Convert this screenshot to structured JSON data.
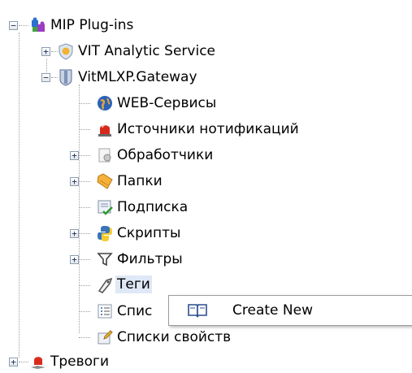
{
  "tree": {
    "root": {
      "label": "MIP Plug-ins",
      "expander": "−"
    },
    "vit_analytic": {
      "label": "VIT Analytic Service",
      "expander": "+"
    },
    "gateway": {
      "label": "VitMLXP.Gateway",
      "expander": "−"
    },
    "children": [
      {
        "label": "WEB-Сервисы",
        "icon": "globe-icon"
      },
      {
        "label": "Источники нотификаций",
        "icon": "alarm-light-icon"
      },
      {
        "label": "Обработчики",
        "icon": "handler-icon",
        "expander": "+"
      },
      {
        "label": "Папки",
        "icon": "folder-icon",
        "expander": "+"
      },
      {
        "label": "Подписка",
        "icon": "subscription-icon"
      },
      {
        "label": "Скрипты",
        "icon": "python-icon",
        "expander": "+"
      },
      {
        "label": "Фильтры",
        "icon": "filter-icon",
        "expander": "+"
      },
      {
        "label": "Теги",
        "icon": "tag-icon"
      },
      {
        "label": "Спис",
        "icon": "list-icon"
      },
      {
        "label": "Списки свойств",
        "icon": "property-list-icon"
      }
    ],
    "alarms": {
      "label": "Тревоги",
      "expander": "+"
    }
  },
  "context_menu": {
    "items": [
      {
        "label": "Create New",
        "icon": "book-icon"
      }
    ]
  },
  "colors": {
    "selection": "#dfe8f6",
    "tree_lines": "#a0a0a0"
  }
}
